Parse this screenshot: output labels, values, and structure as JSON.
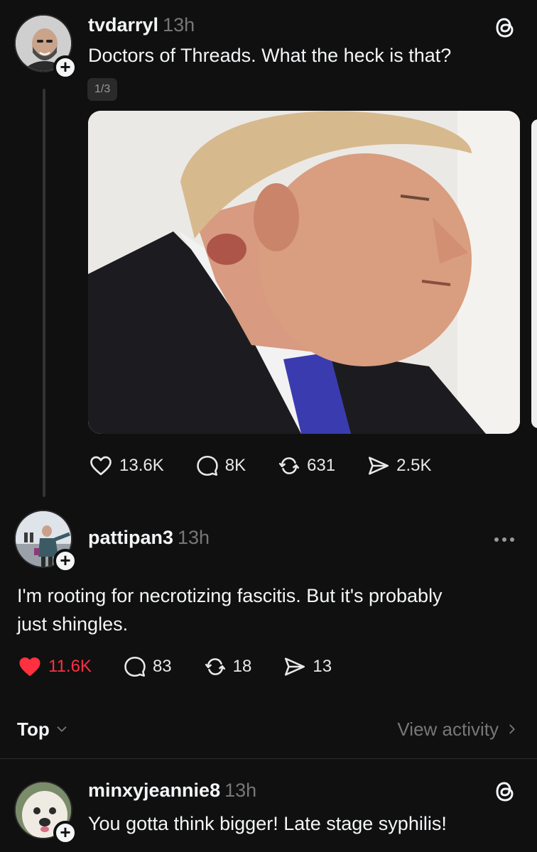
{
  "post": {
    "username": "tvdarryl",
    "time": "13h",
    "text": "Doctors of Threads. What the heck is that?",
    "media_counter": "1/3",
    "stats": {
      "likes": "13.6K",
      "replies": "8K",
      "reposts": "631",
      "shares": "2.5K"
    }
  },
  "reply": {
    "username": "pattipan3",
    "time": "13h",
    "text_line1": "I'm rooting for necrotizing fascitis. But it's probably",
    "text_line2": "just shingles.",
    "stats": {
      "likes": "11.6K",
      "replies": "83",
      "reposts": "18",
      "shares": "13"
    },
    "liked": true
  },
  "sort": {
    "label": "Top",
    "view_activity": "View activity"
  },
  "next_reply": {
    "username": "minxyjeannie8",
    "time": "13h",
    "text": "You gotta think bigger! Late stage syphilis!"
  },
  "colors": {
    "background": "#101010",
    "like_red": "#ff3040",
    "muted": "#777777"
  },
  "icons": [
    "threads-logo-icon",
    "heart-icon",
    "comment-icon",
    "repost-icon",
    "share-icon",
    "more-icon",
    "plus-icon",
    "chevron-down-icon",
    "chevron-right-icon"
  ]
}
